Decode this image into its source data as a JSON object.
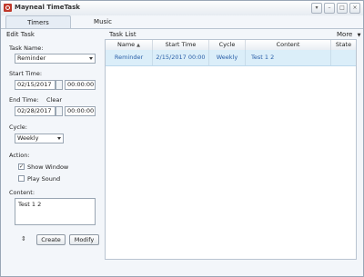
{
  "window": {
    "title": "Mayneal TimeTask"
  },
  "window_buttons": {
    "dropdown": "▾",
    "minimize": "–",
    "maximize": "□",
    "close": "×"
  },
  "tabs": [
    {
      "label": "Timers"
    },
    {
      "label": "Music"
    }
  ],
  "edit_panel": {
    "section_label": "Edit Task",
    "task_name_label": "Task Name:",
    "task_name_value": "Reminder",
    "start_time_label": "Start Time:",
    "start_date": "02/15/2017",
    "start_clock": "00:00:00",
    "end_time_label": "End Time:",
    "clear_label": "Clear",
    "end_date": "02/28/2017",
    "end_clock": "00:00:00",
    "cycle_label": "Cycle:",
    "cycle_value": "Weekly",
    "action_label": "Action:",
    "show_window_label": "Show Window",
    "show_window_checked": true,
    "play_sound_label": "Play Sound",
    "play_sound_checked": false,
    "content_label": "Content:",
    "content_value": "Test 1 2",
    "create_label": "Create",
    "modify_label": "Modify"
  },
  "task_list": {
    "section_label": "Task List",
    "more_label": "More",
    "columns": [
      "Name",
      "Start Time",
      "Cycle",
      "Content",
      "State"
    ],
    "rows": [
      {
        "name": "Reminder",
        "start_time": "2/15/2017 00:00",
        "cycle": "Weekly",
        "content": "Test 1 2",
        "state": ""
      }
    ]
  },
  "colors": {
    "selected_row": "#dbeef9",
    "row_text": "#2a5fa8",
    "app_icon": "#c0392b"
  }
}
